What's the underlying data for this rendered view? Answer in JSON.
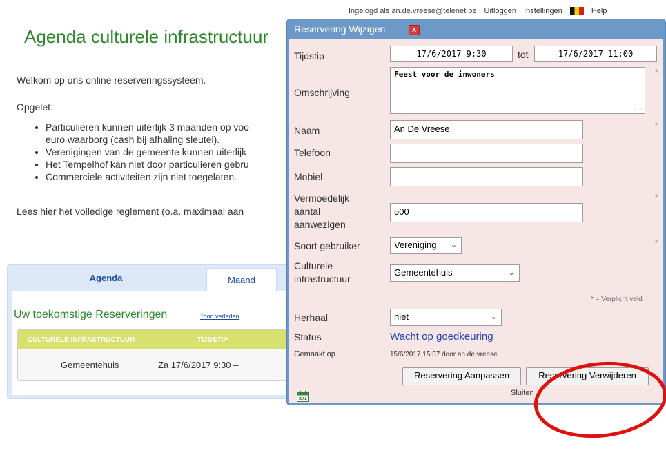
{
  "userbar": {
    "logged_in": "Ingelogd als an.de.vreese@telenet.be",
    "logout": "Uitloggen",
    "settings": "Instellingen",
    "help": "Help"
  },
  "page": {
    "title": "Agenda culturele infrastructuur",
    "welcome": "Welkom op ons online reserveringssysteem.",
    "warning": "Opgelet:",
    "rules": [
      "Particulieren kunnen uiterlijk 3 maanden op voo",
      "euro waarborg (cash bij afhaling sleutel).",
      "Verenigingen van de gemeente kunnen uiterlijk",
      "Het Tempelhof kan niet door particulieren gebru",
      "Commerciele activiteiten zijn niet toegelaten."
    ],
    "reglement": "Lees hier het volledige reglement (o.a. maximaal aan"
  },
  "tabs": {
    "agenda": "Agenda",
    "maand": "Maand"
  },
  "reservations": {
    "title": "Uw toekomstige Reserveringen",
    "show_past": "Toon verleden",
    "columns": [
      "CULTURELE INFRASTRUCTUUR",
      "TIJDSTIP"
    ],
    "rows": [
      {
        "ci": "Gemeentehuis",
        "tijdstip": "Za 17/6/2017 9:30   –"
      }
    ]
  },
  "dialog": {
    "title": "Reservering Wijzigen",
    "close": "x",
    "labels": {
      "tijdstip": "Tijdstip",
      "tot": "tot",
      "omschrijving": "Omschrijving",
      "naam": "Naam",
      "telefoon": "Telefoon",
      "mobiel": "Mobiel",
      "aanwezigen_1": "Vermoedelijk",
      "aanwezigen_2": "aantal",
      "aanwezigen_3": "aanwezigen",
      "soort": "Soort gebruiker",
      "ci_1": "Culturele",
      "ci_2": "infrastructuur",
      "herhaal": "Herhaal",
      "status": "Status",
      "gemaakt": "Gemaakt op"
    },
    "values": {
      "start": "17/6/2017 9:30",
      "end": "17/6/2017 11:00",
      "omschrijving": "Feest voor de inwoners",
      "naam": "An De Vreese",
      "telefoon": "",
      "mobiel": "",
      "aanwezigen": "500",
      "soort": "Vereniging",
      "ci": "Gemeentehuis",
      "herhaal": "niet",
      "status": "Wacht op goedkeuring",
      "gemaakt": "15/6/2017 15:37 door an.de.vreese"
    },
    "required_mark": "*",
    "required_note": "* = Verplicht veld",
    "buttons": {
      "update": "Reservering Aanpassen",
      "delete": "Reservering Verwijderen",
      "close": "Sluiten"
    },
    "ical_label": "ICAL"
  },
  "colors": {
    "title_green": "#2c8a2c",
    "dialog_blue": "#6d99c9",
    "dialog_bg": "#f6e6e6",
    "status_blue": "#2246b6",
    "table_header": "#d8e16e",
    "annotation_red": "#e01010"
  }
}
